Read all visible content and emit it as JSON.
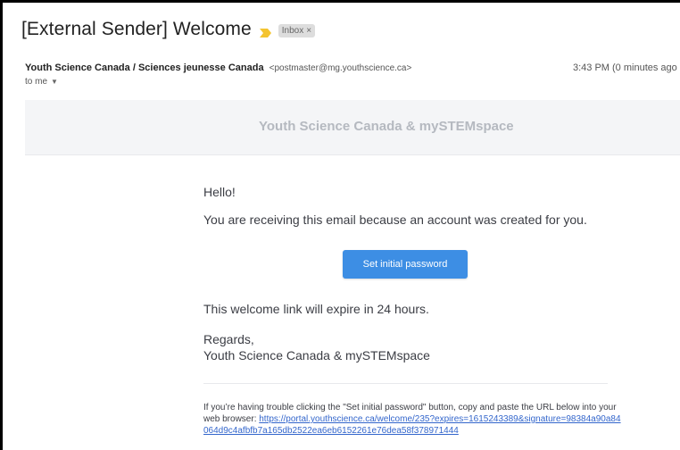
{
  "email": {
    "subject": "[External Sender] Welcome",
    "label_chip": "Inbox",
    "label_remove": "×",
    "sender_name": "Youth Science Canada / Sciences jeunesse Canada",
    "sender_email": "<postmaster@mg.youthscience.ca>",
    "time": "3:43 PM (0 minutes ago",
    "to": "to me",
    "importance_color": "#f4c430"
  },
  "body": {
    "brand": "Youth Science Canada & mySTEMspace",
    "greeting": "Hello!",
    "intro": "You are receiving this email because an account was created for you.",
    "button_label": "Set initial password",
    "expire": "This welcome link will expire in 24 hours.",
    "regards": "Regards,",
    "regards_name": "Youth Science Canada & mySTEMspace",
    "trouble_text": "If you’re having trouble clicking the \"Set initial password\" button, copy and paste the URL below into your web browser:",
    "trouble_link": "https://portal.youthscience.ca/welcome/235?expires=1615243389&signature=98384a90a84064d9c4afbfb7a165db2522ea6eb6152261e76dea58f378971444",
    "accent_color": "#3d8ee4"
  }
}
